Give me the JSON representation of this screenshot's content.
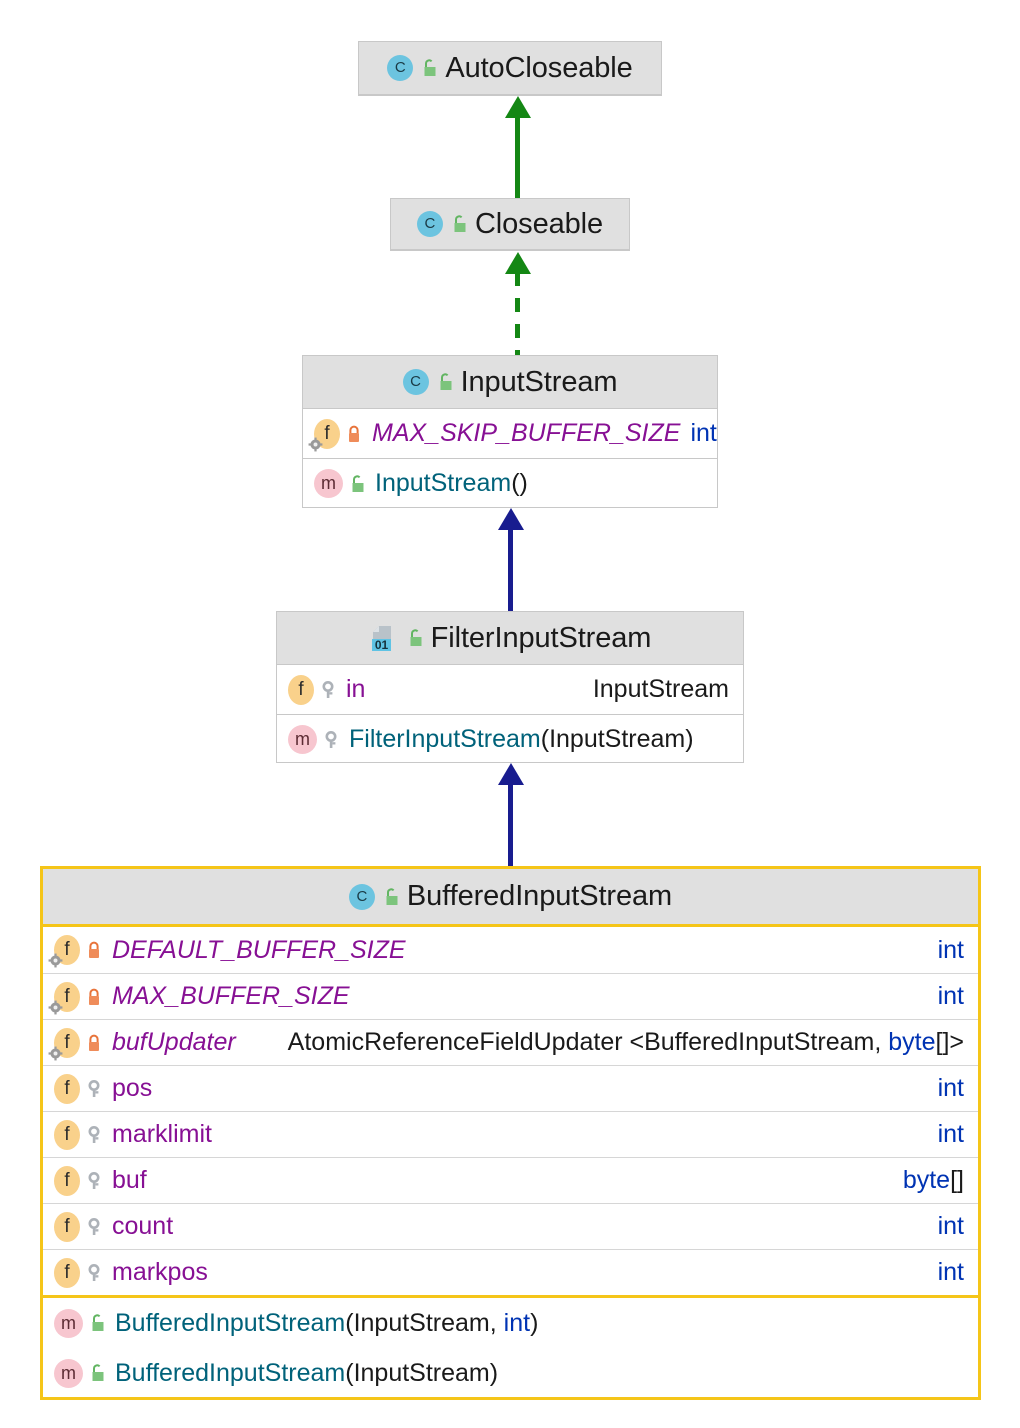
{
  "diagram": {
    "title": "Java IO BufferedInputStream class hierarchy",
    "accent_highlight": "#f5c518",
    "header_fill": "#e0e0e0",
    "inheritance_color": "#181c8f",
    "realization_color": "#148714"
  },
  "classes": [
    {
      "id": "autocloseable",
      "name": "AutoCloseable",
      "kind_icon": "class-icon",
      "visibility_icon": "unlock-green-icon",
      "sections": []
    },
    {
      "id": "closeable",
      "name": "Closeable",
      "kind_icon": "class-icon",
      "visibility_icon": "unlock-green-icon",
      "sections": []
    },
    {
      "id": "inputstream",
      "name": "InputStream",
      "kind_icon": "class-icon",
      "visibility_icon": "unlock-green-icon",
      "sections": [
        {
          "kind": "fields",
          "rows": [
            {
              "member_icon": "static-field-icon",
              "access_icon": "lock-orange-icon",
              "name": "MAX_SKIP_BUFFER_SIZE",
              "name_style": "field-static",
              "type": "int",
              "type_style": "keyword",
              "type_inline": true
            }
          ]
        },
        {
          "kind": "methods",
          "rows": [
            {
              "member_icon": "method-icon",
              "access_icon": "unlock-green-icon",
              "name": "InputStream",
              "name_style": "method",
              "signature": "()",
              "type": "",
              "type_style": "plain"
            }
          ]
        }
      ]
    },
    {
      "id": "filterinputstream",
      "name": "FilterInputStream",
      "kind_icon": "binary-01-icon",
      "visibility_icon": "unlock-green-icon",
      "sections": [
        {
          "kind": "fields",
          "rows": [
            {
              "member_icon": "field-icon",
              "access_icon": "key-gray-icon",
              "name": "in",
              "name_style": "field",
              "type": "InputStream",
              "type_style": "plain"
            }
          ]
        },
        {
          "kind": "methods",
          "rows": [
            {
              "member_icon": "method-icon",
              "access_icon": "key-gray-icon",
              "name": "FilterInputStream",
              "name_style": "method",
              "signature": "(InputStream)",
              "type": "",
              "type_style": "plain"
            }
          ]
        }
      ]
    },
    {
      "id": "bufferedinputstream",
      "name": "BufferedInputStream",
      "kind_icon": "class-icon",
      "visibility_icon": "unlock-green-icon",
      "highlighted": true,
      "sections": [
        {
          "kind": "fields",
          "rows": [
            {
              "member_icon": "static-field-icon",
              "access_icon": "lock-orange-icon",
              "name": "DEFAULT_BUFFER_SIZE",
              "name_style": "field-static",
              "type": "int",
              "type_style": "keyword"
            },
            {
              "member_icon": "static-field-icon",
              "access_icon": "lock-orange-icon",
              "name": "MAX_BUFFER_SIZE",
              "name_style": "field-static",
              "type": "int",
              "type_style": "keyword"
            },
            {
              "member_icon": "static-field-icon",
              "access_icon": "lock-orange-icon",
              "name": "bufUpdater",
              "name_style": "field-static",
              "type": "AtomicReferenceFieldUpdater <BufferedInputStream, byte[]>",
              "type_style": "generic",
              "type_inline": true,
              "type_parts": [
                {
                  "text": "AtomicReferenceFieldUpdater <BufferedInputStream, ",
                  "style": "plain"
                },
                {
                  "text": "byte",
                  "style": "keyword"
                },
                {
                  "text": "[]>",
                  "style": "plain"
                }
              ]
            },
            {
              "member_icon": "field-icon",
              "access_icon": "key-gray-icon",
              "name": "pos",
              "name_style": "field",
              "type": "int",
              "type_style": "keyword"
            },
            {
              "member_icon": "field-icon",
              "access_icon": "key-gray-icon",
              "name": "marklimit",
              "name_style": "field",
              "type": "int",
              "type_style": "keyword"
            },
            {
              "member_icon": "field-icon",
              "access_icon": "key-gray-icon",
              "name": "buf",
              "name_style": "field",
              "type": "byte[]",
              "type_style": "keyword-array",
              "type_parts": [
                {
                  "text": "byte",
                  "style": "keyword"
                },
                {
                  "text": "[]",
                  "style": "plain"
                }
              ]
            },
            {
              "member_icon": "field-icon",
              "access_icon": "key-gray-icon",
              "name": "count",
              "name_style": "field",
              "type": "int",
              "type_style": "keyword"
            },
            {
              "member_icon": "field-icon",
              "access_icon": "key-gray-icon",
              "name": "markpos",
              "name_style": "field",
              "type": "int",
              "type_style": "keyword"
            }
          ]
        },
        {
          "kind": "methods",
          "rows": [
            {
              "member_icon": "method-icon",
              "access_icon": "unlock-green-icon",
              "name": "BufferedInputStream",
              "name_style": "method",
              "signature": "(InputStream, int)",
              "signature_parts": [
                {
                  "text": "(InputStream, ",
                  "style": "plain"
                },
                {
                  "text": "int",
                  "style": "keyword"
                },
                {
                  "text": ")",
                  "style": "plain"
                }
              ]
            },
            {
              "member_icon": "method-icon",
              "access_icon": "unlock-green-icon",
              "name": "BufferedInputStream",
              "name_style": "method",
              "signature": "(InputStream)"
            }
          ]
        }
      ]
    }
  ],
  "connections": [
    {
      "id": "closeable-to-autocloseable",
      "from": "closeable",
      "to": "autocloseable",
      "style": "solid",
      "relation": "generalization",
      "color": "#148714"
    },
    {
      "id": "inputstream-to-closeable",
      "from": "inputstream",
      "to": "closeable",
      "style": "dashed",
      "relation": "realization",
      "color": "#148714"
    },
    {
      "id": "filterinputstream-to-inputstream",
      "from": "filterinputstream",
      "to": "inputstream",
      "style": "solid",
      "relation": "generalization",
      "color": "#181c8f"
    },
    {
      "id": "bufferedinputstream-to-filterinputstream",
      "from": "bufferedinputstream",
      "to": "filterinputstream",
      "style": "solid",
      "relation": "generalization",
      "color": "#181c8f"
    }
  ]
}
